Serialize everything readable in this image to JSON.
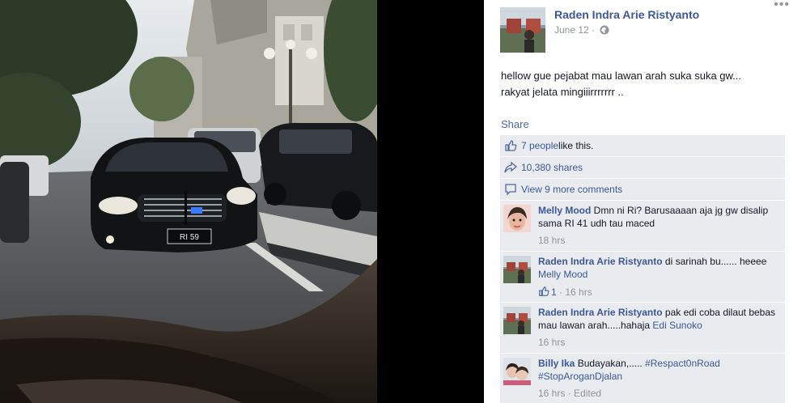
{
  "photo": {
    "plate_text": "RI 59"
  },
  "post": {
    "author_name": "Raden Indra Arie Ristyanto",
    "date": "June 12",
    "separator": "·",
    "caption_line1": "hellow gue pejabat mau lawan arah suka suka gw...",
    "caption_line2": "rakyat jelata mingiiirrrrrrr ..",
    "share_label": "Share"
  },
  "stats": {
    "likes_link": "7 people",
    "likes_suffix": " like this.",
    "shares": "10,380 shares",
    "more_comments": "View 9 more comments"
  },
  "comments": [
    {
      "author": "Melly Mood",
      "text": " Dmn ni Ri? Barusaaaan aja jg gw disalip sama RI 41 udh tau maced",
      "time": "18 hrs"
    },
    {
      "author": "Raden Indra Arie Ristyanto",
      "text": " di sarinah bu...... heeee ",
      "mention": "Melly Mood",
      "likes": "1",
      "separator": "·",
      "time": "16 hrs"
    },
    {
      "author": "Raden Indra Arie Ristyanto",
      "text": " pak edi coba dilaut bebas mau lawan arah.....hahaja ",
      "mention": "Edi Sunoko",
      "time": "16 hrs"
    },
    {
      "author": "Billy Ika",
      "text": " Budayakan,..... ",
      "tag1": "#Respact0nRoad",
      "tag2": "#StopArogan​Djalan",
      "time": "16 hrs",
      "separator": "·",
      "edited": "Edited"
    }
  ],
  "colors": {
    "link": "#3b5998",
    "meta": "#90949c",
    "stats_bg": "#e9ebee"
  },
  "icons": [
    "thumbs-up-icon",
    "share-arrow-icon",
    "comment-icon",
    "globe-icon",
    "more-dots-icon"
  ]
}
